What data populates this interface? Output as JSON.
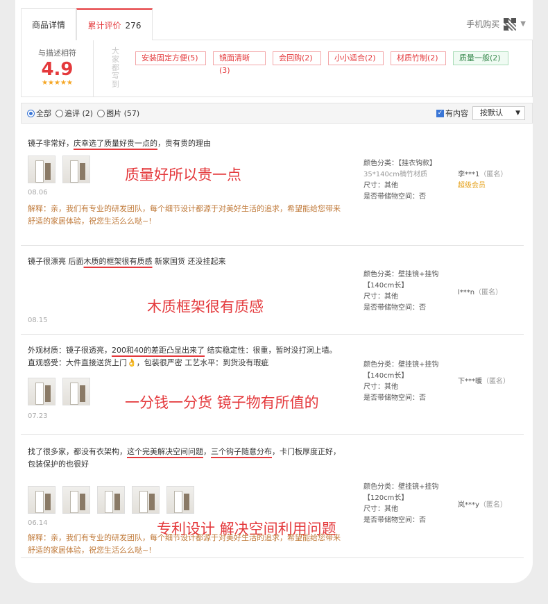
{
  "tabs": {
    "detail": "商品详情",
    "reviews": "累计评价",
    "reviews_count": "276"
  },
  "mobile_buy": "手机购买",
  "summary": {
    "score_label": "与描述相符",
    "score": "4.9",
    "stars": "★★★★★",
    "side_label": "大家都写到",
    "tags": [
      {
        "label": "安装固定方便(5)"
      },
      {
        "label": "镜面清晰(3)"
      },
      {
        "label": "会回购(2)"
      },
      {
        "label": "小小适合(2)"
      },
      {
        "label": "材质竹制(2)"
      },
      {
        "label": "质量一般(2)"
      }
    ]
  },
  "filter": {
    "all": "全部",
    "followup": "追评 (2)",
    "pics": "图片 (57)",
    "has_content": "有内容",
    "sort": "按默认"
  },
  "reviews": [
    {
      "text_a": "镜子非常好，",
      "text_u": "庆幸选了质量好贵一点的",
      "text_b": "，贵有贵的理由",
      "caption": "质量好所以贵一点",
      "date": "08.06",
      "reply": "解释：亲，我们有专业的研发团队，每个细节设计都源于对美好生活的追求，希望能给您带来舒适的家居体验，祝您生活么么哒~!",
      "meta": {
        "color_label": "颜色分类：【挂衣钩款】",
        "color_sub": "35*140cm楠竹材质",
        "size": "尺寸：其他",
        "storage": "是否带储物空间：否"
      },
      "user": {
        "name": "李***1",
        "anon": "（匿名）",
        "vip": "超级会员"
      }
    },
    {
      "text_a": "镜子很漂亮 后面",
      "text_u": "木质的框架很有质感",
      "text_b": " 新家国货 还没挂起来",
      "caption": "木质框架很有质感",
      "date": "08.15",
      "meta": {
        "color_label": "颜色分类：壁挂镜+挂钩",
        "color_sub": "【140cm长】",
        "size": "尺寸：其他",
        "storage": "是否带储物空间：否"
      },
      "user": {
        "name": "l***n",
        "anon": "（匿名）"
      }
    },
    {
      "line1_a": "外观材质：镜子很透亮，",
      "line1_u": "200和40的差距凸显出来了",
      "line1_b": " 结实稳定性：很重，暂时没打洞上墙。",
      "line2": "直观感受：大件直接送货上门👌，包装很严密 工艺水平：到货没有瑕疵",
      "caption": "一分钱一分货 镜子物有所值的",
      "date": "07.23",
      "meta": {
        "color_label": "颜色分类：壁挂镜+挂钩",
        "color_sub": "【140cm长】",
        "size": "尺寸：其他",
        "storage": "是否带储物空间：否"
      },
      "user": {
        "name": "下***暖",
        "anon": "（匿名）"
      }
    },
    {
      "line1_a": "找了很多家，都没有衣架构，",
      "line1_u1": "这个完美解决空间问题",
      "line1_m": "，",
      "line1_u2": "三个钩子随意分布",
      "line1_b": "，卡门板厚度正好，",
      "line2": "包装保护的也很好",
      "caption": "专利设计 解决空间利用问题",
      "date": "06.14",
      "reply": "解释：亲，我们有专业的研发团队，每个细节设计都源于对美好生活的追求，希望能给您带来舒适的家居体验，祝您生活么么哒~!",
      "meta": {
        "color_label": "颜色分类：壁挂镜+挂钩",
        "color_sub": "【120cm长】",
        "size": "尺寸：其他",
        "storage": "是否带储物空间：否"
      },
      "user": {
        "name": "岚***y",
        "anon": "（匿名）"
      }
    }
  ]
}
